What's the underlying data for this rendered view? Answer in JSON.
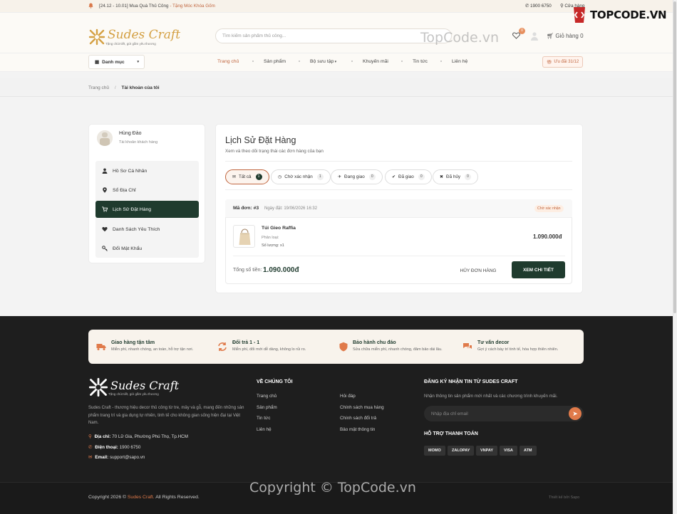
{
  "topbar": {
    "promo_date": "[24.12 - 10.01] Mua Quà Thủ Công",
    "promo_gift": "- Tặng Móc Khóa Gốm",
    "hotline": "1900 6750",
    "store": "Cửa hàng"
  },
  "header": {
    "logo_text": "Sudes Craft",
    "logo_tagline": "Tặng chút tiết, gửi gắm yêu thương",
    "search_placeholder": "Tìm kiếm sản phẩm thủ công...",
    "wishlist_count": "0",
    "cart_label": "Giỏ hàng 0"
  },
  "watermark": {
    "header": "TopCode.vn",
    "brand": "TOPCODE.VN",
    "footer": "Copyright © TopCode.vn"
  },
  "nav": {
    "category_label": "Danh mục",
    "items": [
      "Trang chủ",
      "Sản phẩm",
      "Bộ sưu tập",
      "Khuyến mãi",
      "Tin tức",
      "Liên hệ"
    ],
    "sale_label": "Ưu đãi 31/12"
  },
  "breadcrumb": {
    "home": "Trang chủ",
    "current": "Tài khoản của tôi"
  },
  "sidebar": {
    "user_name": "Hùng Đào",
    "user_role": "Tài khoản khách hàng",
    "menu": [
      "Hồ Sơ Cá Nhân",
      "Sổ Địa Chỉ",
      "Lịch Sử Đặt Hàng",
      "Danh Sách Yêu Thích",
      "Đổi Mật Khẩu"
    ]
  },
  "orders": {
    "title": "Lịch Sử Đặt Hàng",
    "subtitle": "Xem và theo dõi trạng thái các đơn hàng của bạn",
    "tabs": [
      {
        "label": "Tất cả",
        "count": "1"
      },
      {
        "label": "Chờ xác nhận",
        "count": "1"
      },
      {
        "label": "Đang giao",
        "count": "0"
      },
      {
        "label": "Đã giao",
        "count": "0"
      },
      {
        "label": "Đã hủy",
        "count": "0"
      }
    ],
    "order": {
      "code_label": "Mã đơn:",
      "code": "#3",
      "date": "Ngày đặt: 19/06/2026 16:32",
      "status": "Chờ xác nhận",
      "product_name": "Túi Gieo Raffia",
      "variant": "Phân loại:",
      "quantity": "Số lượng: x1",
      "price": "1.090.000đ",
      "total_label": "Tổng số tiền:",
      "total": "1.090.000đ",
      "cancel_label": "HỦY ĐƠN HÀNG",
      "detail_label": "XEM CHI TIẾT"
    }
  },
  "footer": {
    "features": [
      {
        "title": "Giao hàng tận tâm",
        "desc": "Miễn phí, nhanh chóng, an toàn, hỗ trợ tận nơi."
      },
      {
        "title": "Đổi trả 1 - 1",
        "desc": "Miễn phí, đổi mới dễ dàng, không lo rủi ro."
      },
      {
        "title": "Bảo hành chu đáo",
        "desc": "Sửa chữa miễn phí, nhanh chóng, đảm bảo dài lâu."
      },
      {
        "title": "Tư vấn decor",
        "desc": "Gợi ý cách bày trí tinh tế, hòa hợp thiên nhiên."
      }
    ],
    "description": "Sudes Craft - thương hiệu decor thủ công từ tre, mây và gỗ, mang đến những sản phẩm trang trí và gia dụng tự nhiên, tinh tế cho không gian sống hiện đại tại Việt Nam.",
    "address_label": "Địa chỉ:",
    "address": "70 Lữ Gia, Phường Phú Thọ, Tp.HCM",
    "phone_label": "Điện thoại:",
    "phone": "1900 6750",
    "email_label": "Email:",
    "email": "support@sapo.vn",
    "about_title": "VỀ CHÚNG TÔI",
    "about_col1": [
      "Trang chủ",
      "Sản phẩm",
      "Tin tức",
      "Liên hệ"
    ],
    "about_col2": [
      "Hỏi đáp",
      "Chính sách mua hàng",
      "Chính sách đổi trả",
      "Bảo mật thông tin"
    ],
    "newsletter_title": "ĐĂNG KÝ NHẬN TIN TỪ SUDES CRAFT",
    "newsletter_sub": "Nhận thông tin sản phẩm mới nhất và các chương trình khuyến mãi.",
    "email_placeholder": "Nhập địa chỉ email",
    "payment_title": "HỖ TRỢ THANH TOÁN",
    "payments": [
      "MOMO",
      "ZALOPAY",
      "VNPAY",
      "VISA",
      "ATM"
    ],
    "copyright_pre": "Copyright 2026 ©",
    "copyright_brand": "Sudes Craft.",
    "copyright_post": "All Rights Reserved.",
    "designer": "Thiết kế bởi Sapo"
  }
}
